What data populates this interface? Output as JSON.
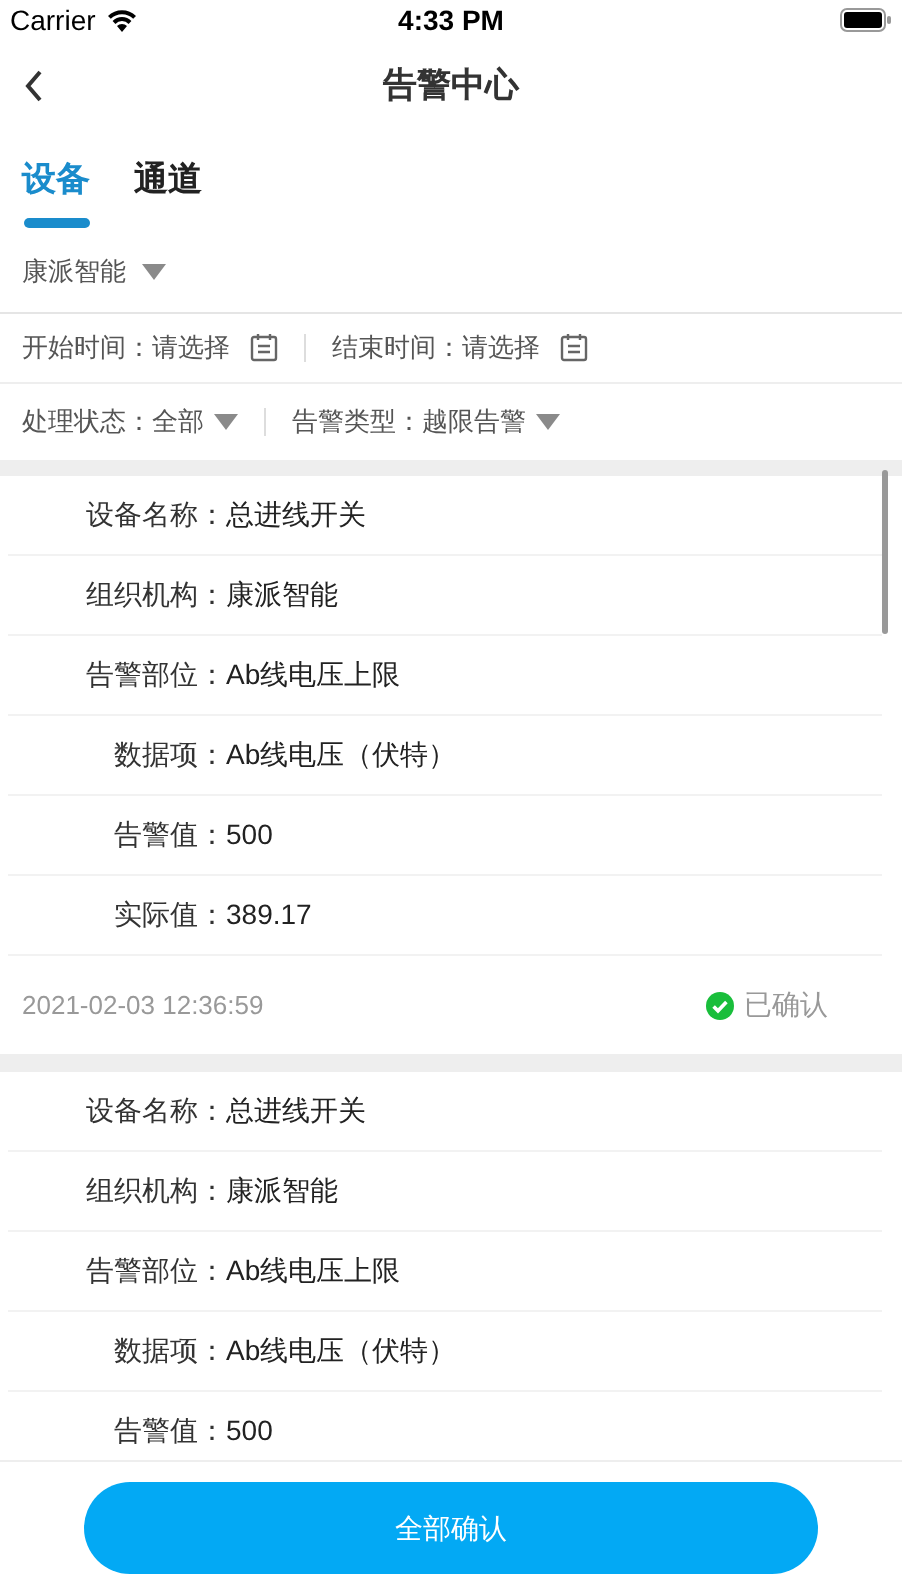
{
  "status_bar": {
    "carrier": "Carrier",
    "time": "4:33 PM"
  },
  "nav": {
    "title": "告警中心"
  },
  "tabs": [
    {
      "label": "设备",
      "selected": true
    },
    {
      "label": "通道",
      "selected": false
    }
  ],
  "org_filter": {
    "value": "康派智能"
  },
  "time_filters": [
    {
      "label": "开始时间：",
      "value": "请选择"
    },
    {
      "label": "结束时间：",
      "value": "请选择"
    }
  ],
  "select_filters": [
    {
      "label": "处理状态：",
      "value": "全部"
    },
    {
      "label": "告警类型：",
      "value": "越限告警"
    }
  ],
  "alarms": [
    {
      "fields": [
        {
          "label": "设备名称：",
          "value": "总进线开关"
        },
        {
          "label": "组织机构：",
          "value": "康派智能"
        },
        {
          "label": "告警部位：",
          "value": "Ab线电压上限"
        },
        {
          "label": "数据项：",
          "value": "Ab线电压（伏特）"
        },
        {
          "label": "告警值：",
          "value": "500"
        },
        {
          "label": "实际值：",
          "value": "389.17"
        }
      ],
      "time": "2021-02-03 12:36:59",
      "status": {
        "text": "已确认",
        "confirmed": true
      }
    },
    {
      "fields": [
        {
          "label": "设备名称：",
          "value": "总进线开关"
        },
        {
          "label": "组织机构：",
          "value": "康派智能"
        },
        {
          "label": "告警部位：",
          "value": "Ab线电压上限"
        },
        {
          "label": "数据项：",
          "value": "Ab线电压（伏特）"
        },
        {
          "label": "告警值：",
          "value": "500"
        }
      ]
    }
  ],
  "confirm_all_button": "全部确认"
}
